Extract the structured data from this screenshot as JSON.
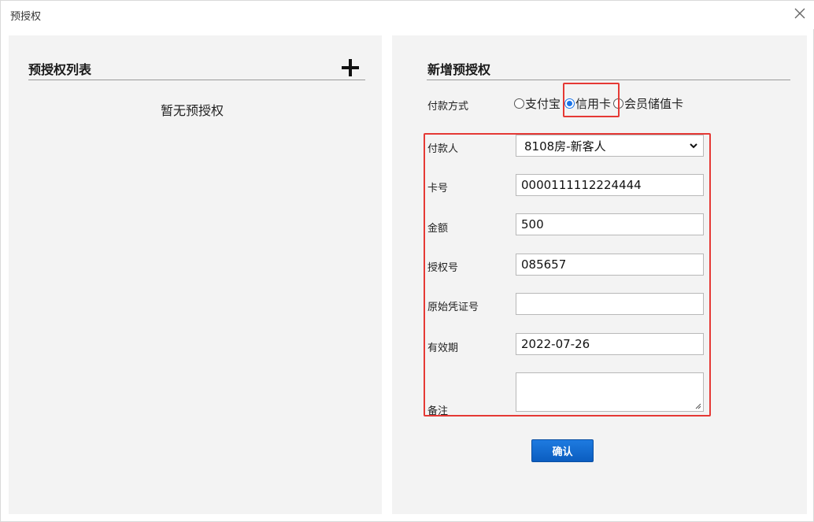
{
  "window": {
    "title": "预授权"
  },
  "left_panel": {
    "heading": "预授权列表",
    "empty_text": "暂无预授权"
  },
  "right_panel": {
    "heading": "新增预授权",
    "payment_method": {
      "label": "付款方式",
      "options": [
        {
          "label": "支付宝",
          "checked": false
        },
        {
          "label": "信用卡",
          "checked": true
        },
        {
          "label": "会员储值卡",
          "checked": false
        }
      ]
    },
    "form": {
      "payer": {
        "label": "付款人",
        "value": "8108房-新客人"
      },
      "card_no": {
        "label": "卡号",
        "value": "0000111112224444"
      },
      "amount": {
        "label": "金额",
        "value": "500"
      },
      "auth_no": {
        "label": "授权号",
        "value": "085657"
      },
      "voucher_no": {
        "label": "原始凭证号",
        "value": ""
      },
      "expiry": {
        "label": "有效期",
        "value": "2022-07-26"
      },
      "remark": {
        "label": "备注",
        "value": ""
      }
    },
    "confirm_label": "确认"
  },
  "colors": {
    "accent": "#1a73e8",
    "highlight": "#e53935",
    "button": "#0b5dc0",
    "panel_bg": "#f3f3f3"
  }
}
